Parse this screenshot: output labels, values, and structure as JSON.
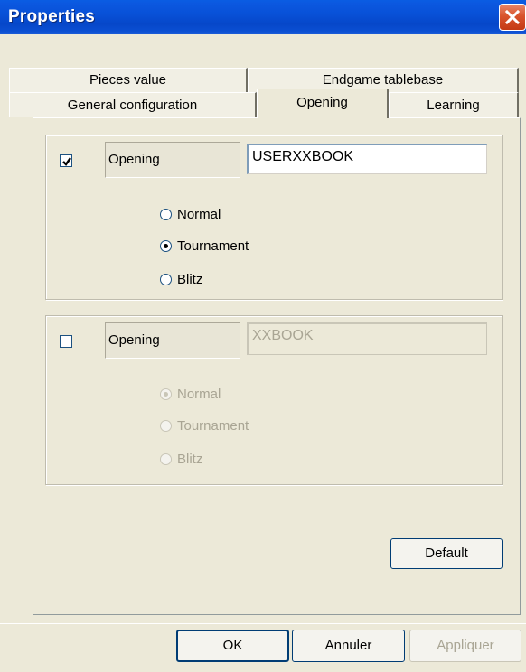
{
  "window": {
    "title": "Properties"
  },
  "tabs": {
    "row1": [
      {
        "label": "Pieces value"
      },
      {
        "label": "Endgame tablebase"
      }
    ],
    "row2": [
      {
        "label": "General configuration"
      },
      {
        "label": "Opening",
        "active": true
      },
      {
        "label": "Learning"
      }
    ]
  },
  "group1": {
    "checked": true,
    "label": "Opening",
    "value": "USERXXBOOK",
    "options": [
      {
        "label": "Normal",
        "selected": false
      },
      {
        "label": "Tournament",
        "selected": true
      },
      {
        "label": "Blitz",
        "selected": false
      }
    ]
  },
  "group2": {
    "checked": false,
    "disabled": true,
    "label": "Opening",
    "value": "XXBOOK",
    "options": [
      {
        "label": "Normal",
        "selected": true
      },
      {
        "label": "Tournament",
        "selected": false
      },
      {
        "label": "Blitz",
        "selected": false
      }
    ]
  },
  "buttons": {
    "default": "Default",
    "ok": "OK",
    "cancel": "Annuler",
    "apply": "Appliquer"
  },
  "colors": {
    "titlebar": "#0a4fd2",
    "face": "#ece9d8",
    "close": "#d9532c"
  }
}
